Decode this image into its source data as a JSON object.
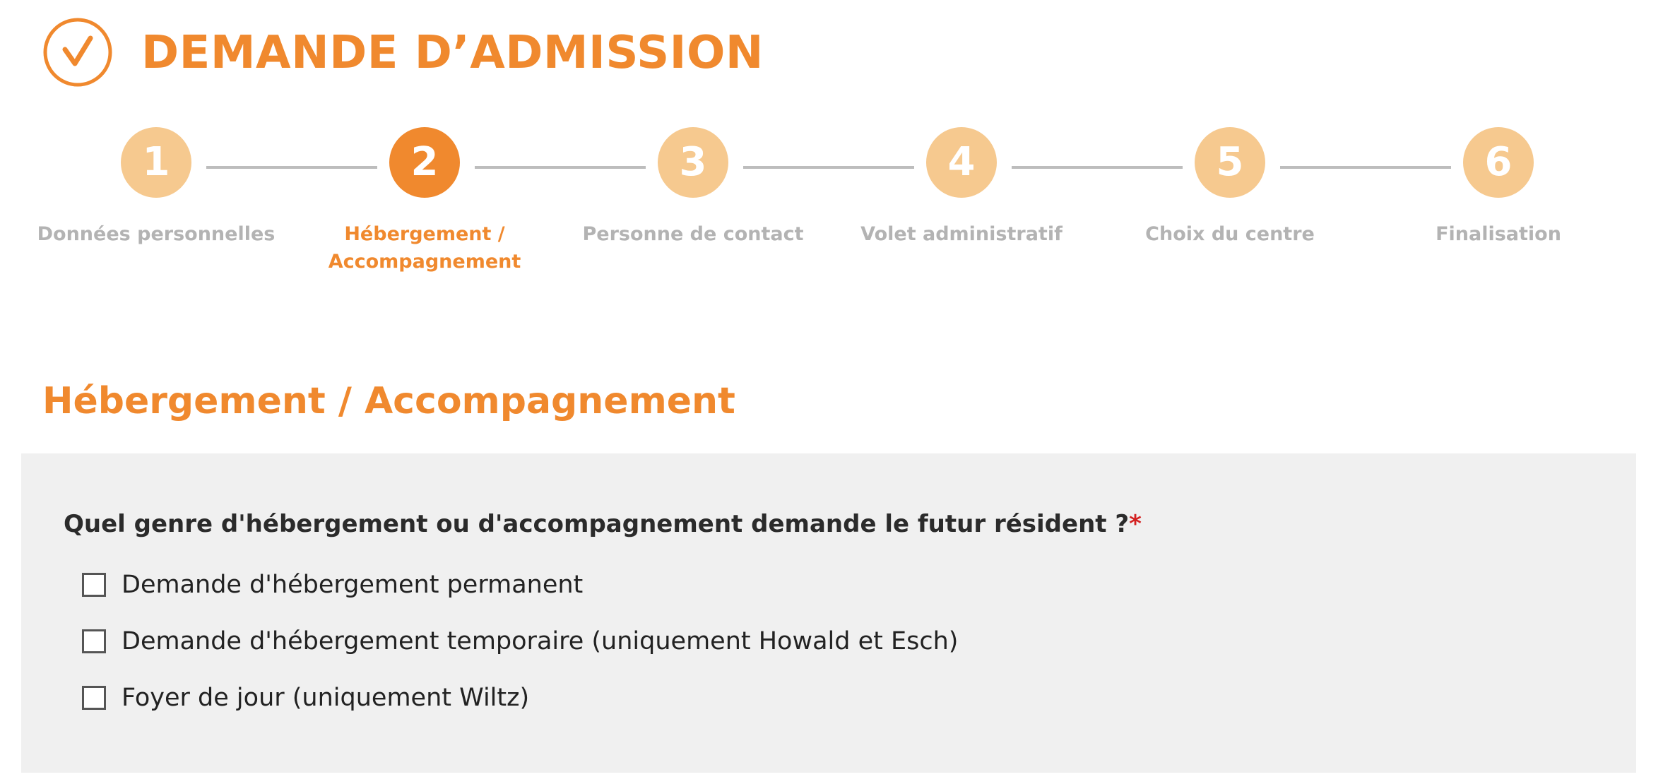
{
  "header": {
    "icon": "check-circle-icon",
    "title": "DEMANDE D’ADMISSION"
  },
  "colors": {
    "accent": "#f0892e",
    "accent_light": "#f6c98f",
    "inactive_text": "#b3b3b3",
    "panel_bg": "#f0f0f0",
    "required": "#d32020"
  },
  "stepper": {
    "current_step": 2,
    "steps": [
      {
        "number": "1",
        "label": "Données personnelles"
      },
      {
        "number": "2",
        "label": "Hébergement / Accompagnement"
      },
      {
        "number": "3",
        "label": "Personne de contact"
      },
      {
        "number": "4",
        "label": "Volet administratif"
      },
      {
        "number": "5",
        "label": "Choix du centre"
      },
      {
        "number": "6",
        "label": "Finalisation"
      }
    ]
  },
  "section": {
    "title": "Hébergement / Accompagnement",
    "question": "Quel genre d'hébergement ou d'accompagnement demande le futur résident ?",
    "required_marker": "*",
    "options": [
      {
        "label": "Demande d'hébergement permanent",
        "checked": false
      },
      {
        "label": "Demande d'hébergement temporaire (uniquement Howald et Esch)",
        "checked": false
      },
      {
        "label": "Foyer de jour (uniquement Wiltz)",
        "checked": false
      }
    ]
  }
}
